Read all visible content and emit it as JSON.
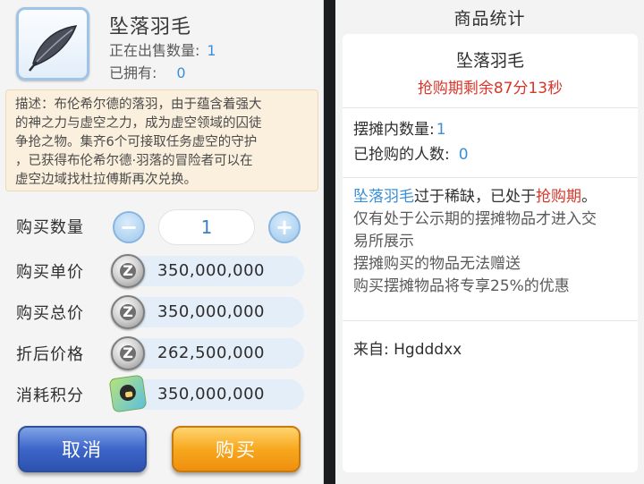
{
  "left": {
    "item_name": "坠落羽毛",
    "on_sale_label": "正在出售数量:",
    "on_sale_value": "1",
    "owned_label": "已拥有:",
    "owned_value": "0",
    "description_lines": [
      "描述：布伦希尔德的落羽，由于蕴含着强大",
      "的神之力与虚空之力，成为虚空领域的囚徒",
      "争抢之物。集齐6个可接取任务虚空的守护",
      "，已获得布伦希尔德·羽落的冒险者可以在",
      "虚空边域找杜拉傅斯再次兑换。"
    ],
    "qty_label": "购买数量",
    "qty_value": "1",
    "minus_symbol": "−",
    "plus_symbol": "+",
    "unit_price_label": "购买单价",
    "unit_price_value": "350,000,000",
    "total_price_label": "购买总价",
    "total_price_value": "350,000,000",
    "discount_price_label": "折后价格",
    "discount_price_value": "262,500,000",
    "points_label": "消耗积分",
    "points_value": "350,000,000",
    "coin_glyph": "Z",
    "cancel_label": "取消",
    "buy_label": "购买"
  },
  "right": {
    "title": "商品统计",
    "item_name": "坠落羽毛",
    "countdown": "抢购期剩余87分13秒",
    "booth_count_label": "摆摊内数量:",
    "booth_count_value": "1",
    "buyers_label": "已抢购的人数:",
    "buyers_value": "0",
    "notice_item": "坠落羽毛",
    "notice_mid": "过于稀缺，已处于",
    "notice_period": "抢购期",
    "notice_end": "。",
    "notice_lines": [
      "仅有处于公示期的摆摊物品才进入交",
      "易所展示",
      "摆摊购买的物品无法赠送",
      "购买摆摊物品将专享25%的优惠"
    ],
    "from_label": "来自:",
    "from_value": "Hgdddxx"
  },
  "colors": {
    "accent_blue": "#3b8fd6",
    "alert_red": "#d8362a",
    "cancel_button": "#3d66c9",
    "buy_button": "#f7a81e",
    "description_bg": "#fbf0dd"
  },
  "icons": {
    "item": "feather-icon",
    "currency": "zeny-coin-icon",
    "points": "points-icon",
    "minus": "minus-icon",
    "plus": "plus-icon"
  }
}
